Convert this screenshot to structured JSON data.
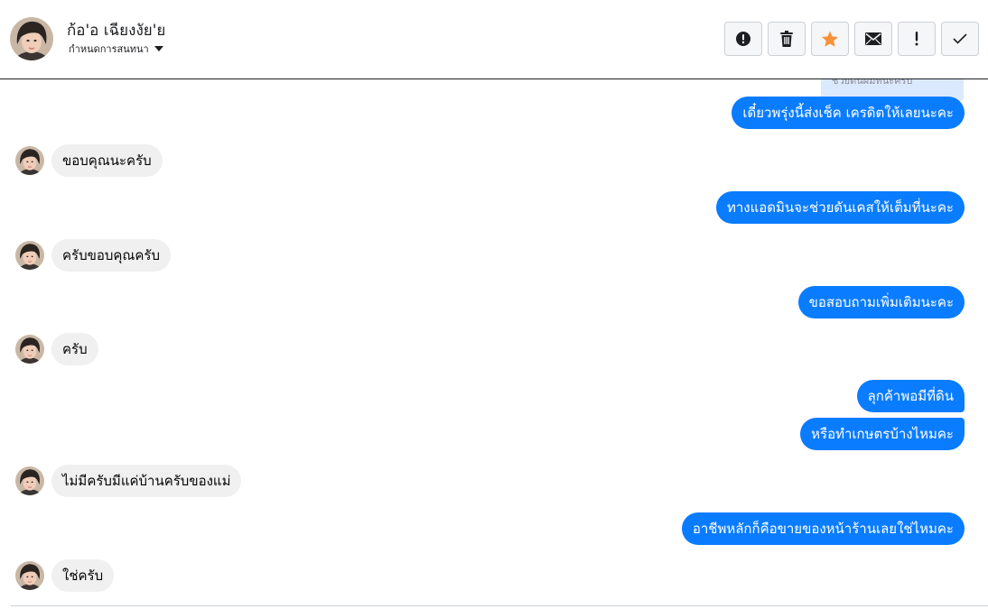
{
  "header": {
    "contact_name": "ก้อ'อ เฉียงงัย'ย",
    "conversation_menu_label": "กำหนดการสนทนา",
    "toolbar": [
      {
        "name": "report-button",
        "icon": "alert-circle-icon"
      },
      {
        "name": "delete-button",
        "icon": "trash-icon"
      },
      {
        "name": "star-button",
        "icon": "star-icon"
      },
      {
        "name": "mark-unread-button",
        "icon": "envelope-icon"
      },
      {
        "name": "important-button",
        "icon": "exclamation-icon"
      },
      {
        "name": "done-button",
        "icon": "checkmark-icon"
      }
    ]
  },
  "thread": {
    "quoted_snippet": "ช่วยดันผมทีนะครับ",
    "messages": [
      {
        "direction": "out",
        "text": "เดี๋ยวพรุ่งนี้ส่งเช็ค เครดิตให้เลยนะคะ"
      },
      {
        "direction": "in",
        "text": "ขอบคุณนะครับ"
      },
      {
        "direction": "out",
        "text": "ทางแอดมินจะช่วยดันเคสให้เต็มที่นะคะ"
      },
      {
        "direction": "in",
        "text": "ครับขอบคุณครับ"
      },
      {
        "direction": "out",
        "text": "ขอสอบถามเพิ่มเติมนะคะ"
      },
      {
        "direction": "in",
        "text": "ครับ"
      },
      {
        "direction": "out",
        "text": "ลุกค้าพอมีที่ดิน"
      },
      {
        "direction": "out",
        "text": "หรือทำเกษตรบ้างไหมคะ"
      },
      {
        "direction": "in",
        "text": "ไม่มีครับมีแค่บ้านครับของแม่"
      },
      {
        "direction": "out",
        "text": "อาชีพหลักก็คือขายของหน้าร้านเลยใช่ไหมคะ"
      },
      {
        "direction": "in",
        "text": "ใช่ครับ"
      }
    ]
  },
  "colors": {
    "outgoing_bubble": "#0a7cff",
    "incoming_bubble": "#f0f0f0",
    "star_accent": "#f7923a"
  }
}
